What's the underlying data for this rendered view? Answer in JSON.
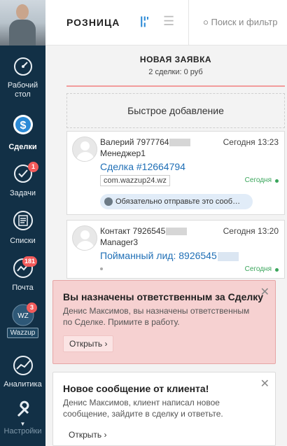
{
  "header": {
    "title": "РОЗНИЦА",
    "search_placeholder": "Поиск и фильтр"
  },
  "sidebar": {
    "items": [
      {
        "label": "Рабочий стол",
        "icon": "dashboard-icon"
      },
      {
        "label": "Сделки",
        "icon": "deals-icon"
      },
      {
        "label": "Задачи",
        "icon": "tasks-icon",
        "badge": "1"
      },
      {
        "label": "Списки",
        "icon": "lists-icon"
      },
      {
        "label": "Почта",
        "icon": "mail-icon",
        "badge": "181"
      },
      {
        "label": "Wazzup",
        "icon": "wazzup-icon",
        "badge": "3",
        "avatar_text": "WZ"
      },
      {
        "label": "Аналитика",
        "icon": "analytics-icon"
      },
      {
        "label": "Настройки",
        "icon": "settings-icon"
      }
    ]
  },
  "column": {
    "title": "НОВАЯ ЗАЯВКА",
    "subtitle": "2 сделки: 0 руб",
    "quick_add": "Быстрое добавление"
  },
  "cards": [
    {
      "name": "Валерий 7977764",
      "time": "Сегодня 13:23",
      "role": "Менеджер1",
      "deal": "Сделка #12664794",
      "tag": "com.wazzup24.wz",
      "status": "Сегодня",
      "message": "Обязательно отправьте это сооб…"
    },
    {
      "name": "Контакт 7926545",
      "time": "Сегодня 13:20",
      "role": "Manager3",
      "deal": "Пойманный лид: 8926545",
      "status": "Сегодня"
    }
  ],
  "notifications": [
    {
      "title": "Вы назначены ответственным за Сделку",
      "body": "Денис Максимов, вы назначены ответственным по Сделке. Примите в работу.",
      "action": "Открыть ›"
    },
    {
      "title": "Новое сообщение от клиента!",
      "body": "Денис Максимов, клиент написал новое сообщение, зайдите в сделку и ответьте.",
      "action": "Открыть ›"
    }
  ],
  "colors": {
    "sidebar_bg": "#123046",
    "accent": "#2b8ad6",
    "status_green": "#3aa55b",
    "badge_red": "#f25b5b"
  }
}
